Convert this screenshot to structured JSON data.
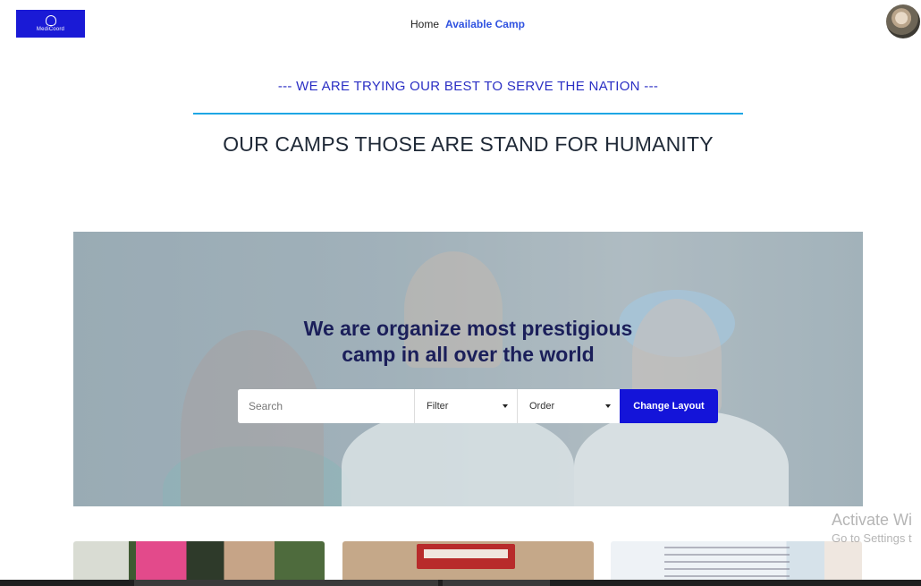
{
  "brand": {
    "name": "MediCoord"
  },
  "nav": {
    "home": "Home",
    "available_camp": "Available Camp"
  },
  "header": {
    "tagline": "--- WE ARE TRYING OUR BEST TO SERVE THE NATION ---",
    "title": "OUR CAMPS THOSE ARE STAND FOR HUMANITY"
  },
  "hero": {
    "title_line1": "We are organize most prestigious",
    "title_line2": "camp in all over the world",
    "search": {
      "placeholder": "Search"
    },
    "filter": {
      "label": "Filter"
    },
    "order": {
      "label": "Order"
    },
    "change_layout": "Change Layout"
  },
  "watermark": {
    "line1": "Activate Wi",
    "line2": "Go to Settings t"
  },
  "colors": {
    "accent": "#1414d9",
    "nav_active": "#2f52e0",
    "rule": "#1ea6e4",
    "tagline": "#2b2fc4"
  }
}
